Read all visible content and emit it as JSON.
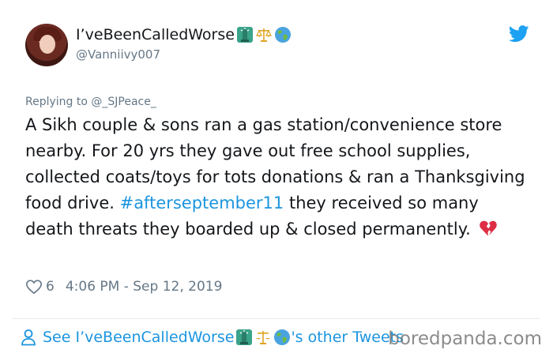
{
  "user": {
    "display_name": "I’veBeenCalledWorse",
    "handle": "@Vanniivy007",
    "name_emojis": [
      "statue-of-liberty-icon",
      "scales-icon",
      "globe-icon"
    ]
  },
  "reply": {
    "prefix": "Replying to ",
    "mention": "@_SJPeace_"
  },
  "tweet": {
    "text_before": "A Sikh couple & sons ran a gas station/convenience store nearby. For 20 yrs they gave out free school supplies, collected coats/toys for tots donations & ran a Thanksgiving food drive. ",
    "hashtag": "#afterseptember11",
    "text_after": " they received so many death threats they boarded up & closed permanently. ",
    "trailing_emoji": "broken-heart-icon"
  },
  "meta": {
    "likes": "6",
    "timestamp": "4:06 PM - Sep 12, 2019"
  },
  "footer": {
    "prefix": "See I’veBeenCalledWorse",
    "suffix": "'s other Tweets"
  },
  "watermark": "boredpanda.com",
  "colors": {
    "link_blue": "#1b95e0",
    "secondary_text": "#657786",
    "twitter_bird": "#1da1f2"
  }
}
